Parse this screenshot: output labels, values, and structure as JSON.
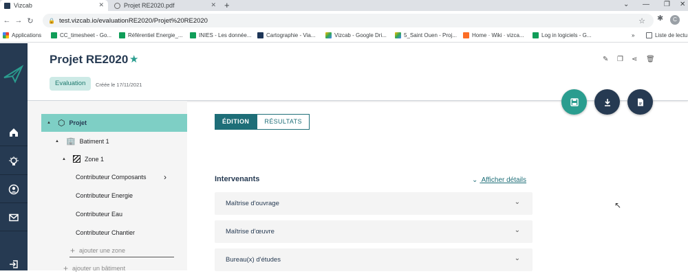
{
  "browser": {
    "tabs": [
      {
        "title": "Vizcab"
      },
      {
        "title": "Projet RE2020.pdf"
      }
    ],
    "new_tab": "+",
    "url": "test.vizcab.io/evaluationRE2020/Projet%20RE2020",
    "profile_initial": "C",
    "bookmarks": [
      {
        "label": "Applications",
        "color": "#ea4335"
      },
      {
        "label": "CC_timesheet - Go...",
        "color": "#0f9d58"
      },
      {
        "label": "Référentiel Energie_...",
        "color": "#0f9d58"
      },
      {
        "label": "INIES - Les donnée...",
        "color": "#0f9d58"
      },
      {
        "label": "Cartographie - Via...",
        "color": "#1d3557"
      },
      {
        "label": "Vizcab - Google Dri...",
        "color": "#fbbc04"
      },
      {
        "label": "5_Saint Ouen - Proj...",
        "color": "#fbbc04"
      },
      {
        "label": "Home · Wiki · vizca...",
        "color": "#fc6d26"
      },
      {
        "label": "Log in logiciels - G...",
        "color": "#0f9d58"
      }
    ],
    "bookmarks_more": "»",
    "reading_list": "Liste de lectu"
  },
  "header": {
    "title": "Projet RE2020",
    "badge": "Evaluation",
    "created": "Créée le 17/11/2021"
  },
  "tree": {
    "project": "Projet",
    "building": "Batiment 1",
    "zone": "Zone 1",
    "contributors": [
      "Contributeur Composants",
      "Contributeur Energie",
      "Contributeur Eau",
      "Contributeur Chantier"
    ],
    "add_zone": "ajouter une zone",
    "add_building": "ajouter un bâtiment"
  },
  "main": {
    "tab_edit": "ÉDITION",
    "tab_results": "RÉSULTATS",
    "section_title": "Intervenants",
    "details_link": "Afficher détails",
    "accordions": [
      "Maîtrise d'ouvrage",
      "Maîtrise d'œuvre",
      "Bureau(x) d'études"
    ]
  },
  "colors": {
    "sidebar": "#263a52",
    "accent": "#2a9d8f",
    "tab_active": "#1e6e78",
    "tree_selected": "#7ecfc5"
  }
}
